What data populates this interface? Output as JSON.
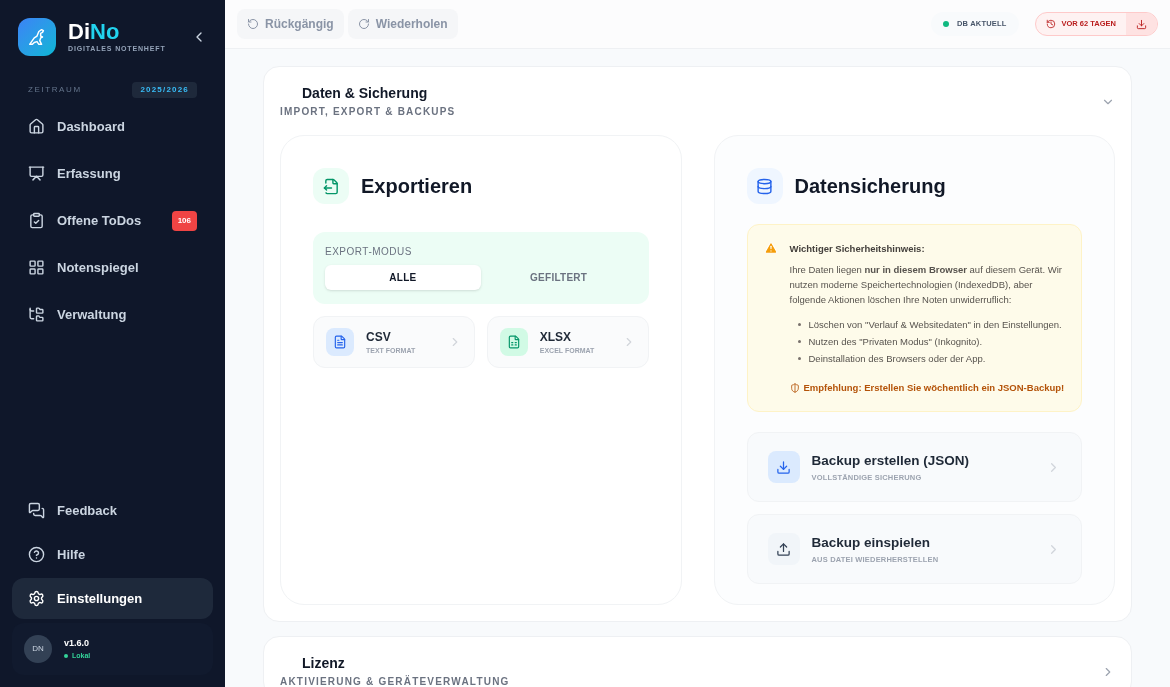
{
  "sidebar": {
    "brand": {
      "name_start": "Di",
      "name_end": "No",
      "subtitle": "DIGITALES NOTENHEFT"
    },
    "period": {
      "label": "ZEITRAUM",
      "value": "2025/2026"
    },
    "nav": [
      {
        "label": "Dashboard",
        "kind": "home",
        "selected": false
      },
      {
        "label": "Erfassung",
        "kind": "entry",
        "selected": false
      },
      {
        "label": "Offene ToDos",
        "kind": "todo",
        "selected": false,
        "badge": "106"
      },
      {
        "label": "Notenspiegel",
        "kind": "grid",
        "selected": false
      },
      {
        "label": "Verwaltung",
        "kind": "tree",
        "selected": false
      }
    ],
    "footer_nav": [
      {
        "label": "Feedback",
        "kind": "chat",
        "selected": false
      },
      {
        "label": "Hilfe",
        "kind": "help",
        "selected": false
      },
      {
        "label": "Einstellungen",
        "kind": "settings",
        "selected": true
      }
    ],
    "user": {
      "initials": "DN",
      "version": "v1.6.0",
      "status": "Lokal"
    }
  },
  "toolbar": {
    "undo": {
      "label": "Rückgängig",
      "disabled": true
    },
    "redo": {
      "label": "Wiederholen",
      "disabled": true
    },
    "db_status": "DB AKTUELL",
    "backup_age": "VOR 62 TAGEN"
  },
  "sections": [
    {
      "title": "Daten & Sicherung",
      "subtitle": "IMPORT, EXPORT & BACKUPS",
      "expanded": true
    },
    {
      "title": "Lizenz",
      "subtitle": "AKTIVIERUNG & GERÄTEVERWALTUNG",
      "expanded": false
    }
  ],
  "export": {
    "title": "Exportieren",
    "mode_label": "EXPORT-MODUS",
    "modes": [
      {
        "label": "ALLE",
        "selected": true
      },
      {
        "label": "GEFILTERT",
        "selected": false
      }
    ],
    "formats": [
      {
        "kind": "csv",
        "title": "CSV",
        "subtitle": "TEXT FORMAT"
      },
      {
        "kind": "xlsx",
        "title": "XLSX",
        "subtitle": "EXCEL FORMAT"
      }
    ]
  },
  "backup": {
    "title": "Datensicherung",
    "notice": {
      "title": "Wichtiger Sicherheitshinweis:",
      "text": "Ihre Daten liegen **nur in diesem Browser** auf diesem Gerät. Wir nutzen moderne Speichertechnologien (IndexedDB), aber folgende Aktionen löschen Ihre Noten unwiderruflich:",
      "items": [
        "Löschen von \"Verlauf & Websitedaten\" in den Einstellungen.",
        "Nutzen des \"Privaten Modus\" (Inkognito).",
        "Deinstallation des Browsers oder der App."
      ],
      "recommendation": "Empfehlung: Erstellen Sie wöchentlich ein JSON-Backup!"
    },
    "actions": [
      {
        "kind": "download",
        "title": "Backup erstellen (JSON)",
        "subtitle": "VOLLSTÄNDIGE SICHERUNG"
      },
      {
        "kind": "upload",
        "title": "Backup einspielen",
        "subtitle": "AUS DATEI WIEDERHERSTELLEN"
      }
    ]
  }
}
